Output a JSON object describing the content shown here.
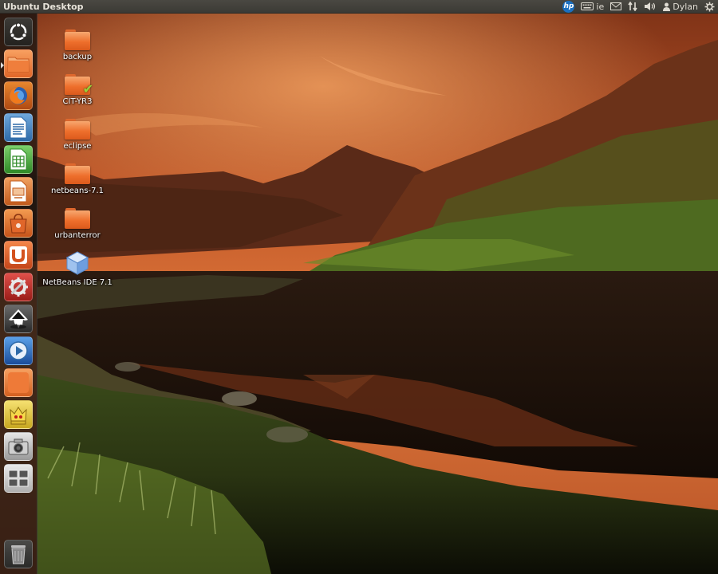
{
  "top_panel": {
    "title": "Ubuntu Desktop",
    "keyboard_layout": "ie",
    "user_name": "Dylan"
  },
  "launcher": {
    "items": [
      {
        "name": "dash-home-icon"
      },
      {
        "name": "home-folder-icon"
      },
      {
        "name": "firefox-icon"
      },
      {
        "name": "libreoffice-writer-icon"
      },
      {
        "name": "libreoffice-calc-icon"
      },
      {
        "name": "libreoffice-impress-icon"
      },
      {
        "name": "ubuntu-software-center-icon"
      },
      {
        "name": "ubuntu-one-icon"
      },
      {
        "name": "system-settings-icon"
      },
      {
        "name": "inkscape-icon"
      },
      {
        "name": "media-player-icon"
      },
      {
        "name": "workspace-app-icon"
      },
      {
        "name": "game-app-icon"
      },
      {
        "name": "screenshot-camera-icon"
      },
      {
        "name": "workspace-switcher-icon"
      },
      {
        "name": "trash-icon"
      }
    ]
  },
  "desktop_icons": [
    {
      "label": "backup",
      "type": "folder"
    },
    {
      "label": "CIT-YR3",
      "type": "folder-check"
    },
    {
      "label": "eclipse",
      "type": "folder"
    },
    {
      "label": "netbeans-7.1",
      "type": "folder"
    },
    {
      "label": "urbanterror",
      "type": "folder"
    },
    {
      "label": "NetBeans IDE 7.1",
      "type": "app"
    }
  ],
  "colors": {
    "folder_orange": "#ee6f2c",
    "sky_orange": "#c65a2c",
    "launcher_bg": "#141210"
  }
}
